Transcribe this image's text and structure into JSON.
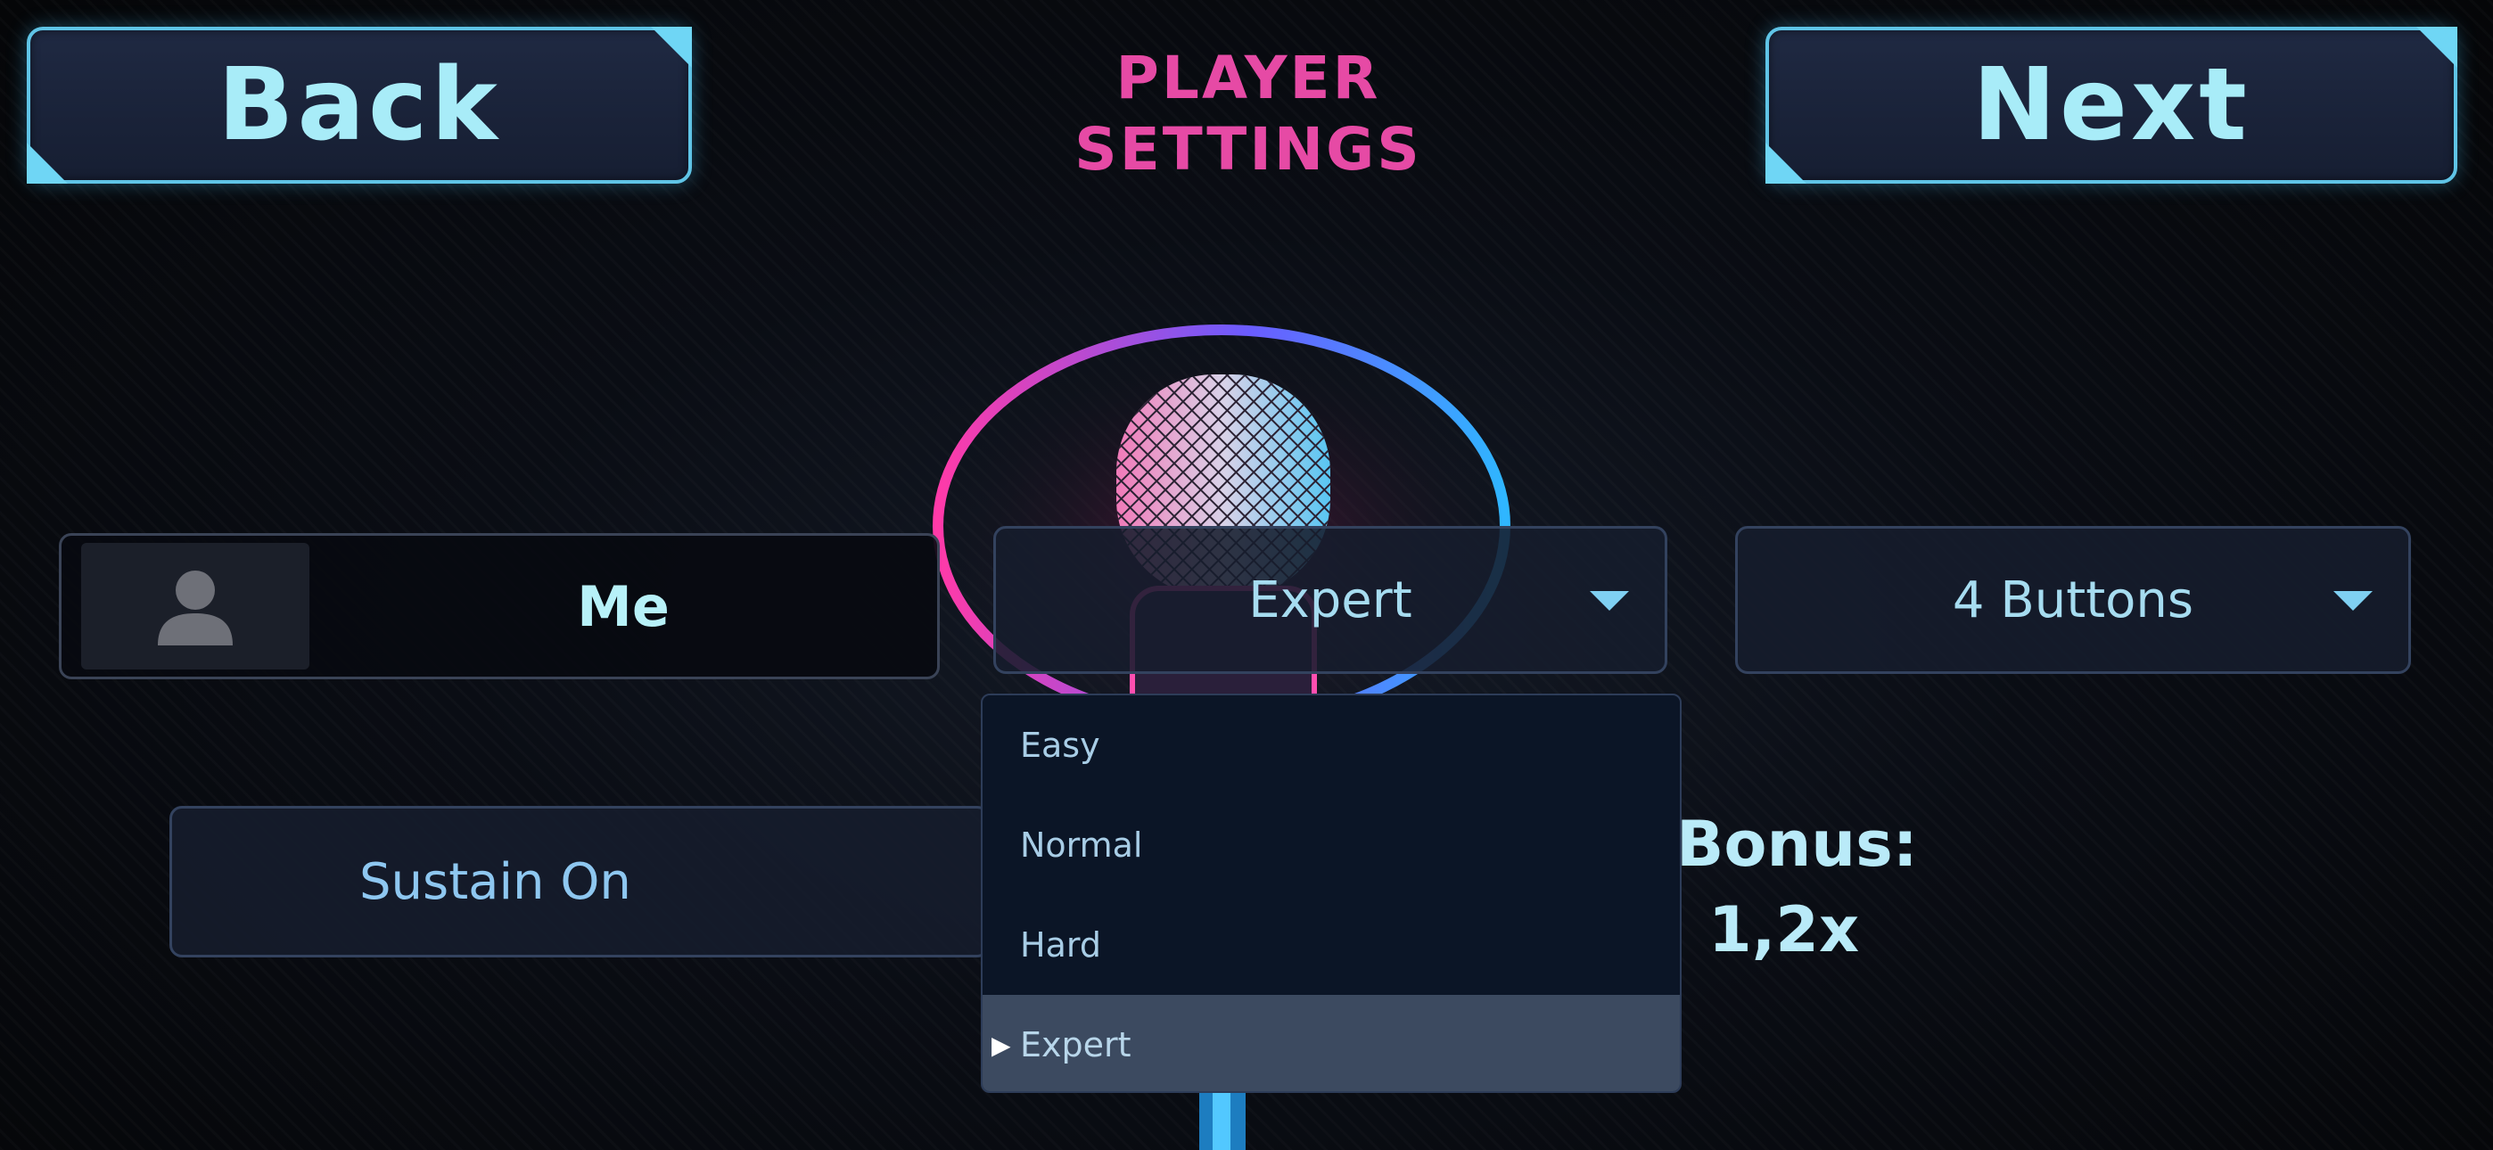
{
  "header": {
    "back_label": "Back",
    "next_label": "Next",
    "title_line1": "PLAYER",
    "title_line2": "SETTINGS"
  },
  "player": {
    "name": "Me",
    "avatar_icon": "user-silhouette-icon"
  },
  "difficulty": {
    "selected": "Expert",
    "options": [
      "Easy",
      "Normal",
      "Hard",
      "Expert"
    ]
  },
  "buttons_mode": {
    "selected": "4 Buttons"
  },
  "sustain": {
    "label": "Sustain On"
  },
  "bonus": {
    "label": "Bonus:",
    "value": "1,2x"
  },
  "colors": {
    "accent_cyan": "#5fc4e6",
    "title_pink": "#e64aa5",
    "text_blue": "#a6dcf0"
  }
}
